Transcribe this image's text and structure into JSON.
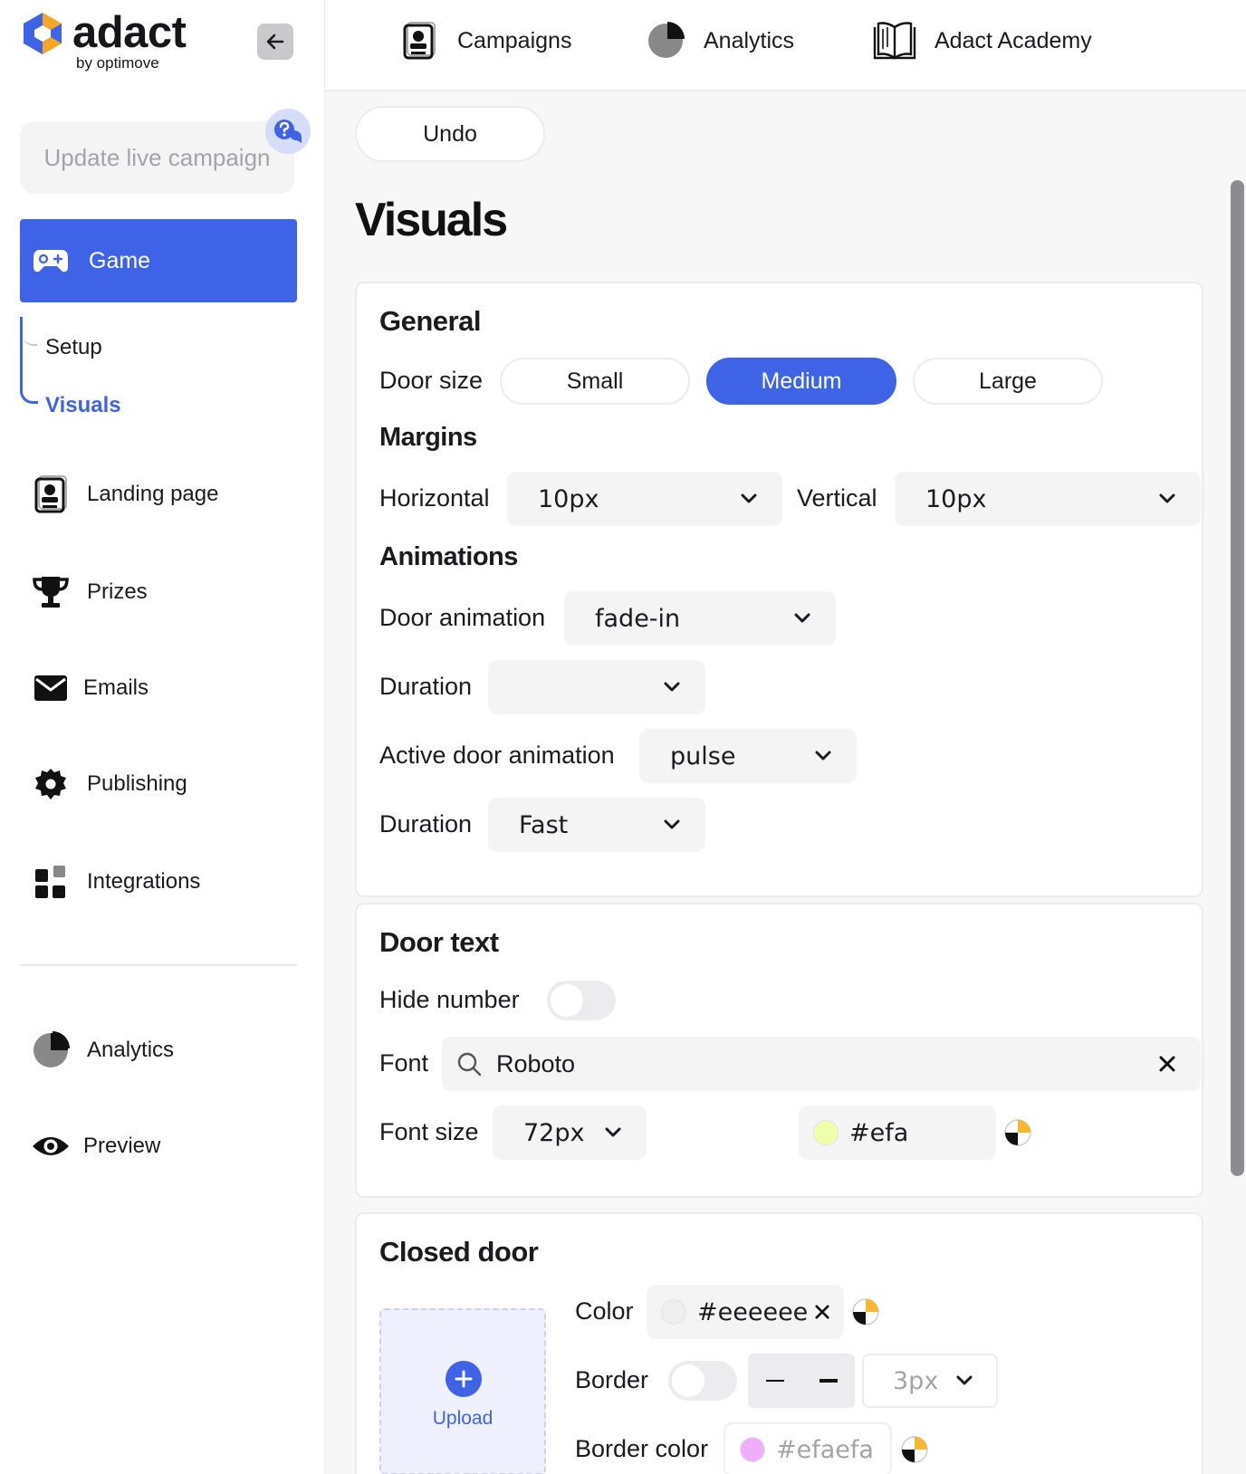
{
  "brand": {
    "name": "adact",
    "tagline": "by optimove",
    "colors": {
      "accent": "#3f63e6",
      "logo_orange": "#f5a623",
      "logo_blue": "#3f63e6"
    }
  },
  "sidebar": {
    "collapse_icon": "arrow-left-icon",
    "update_button": "Update live campaign",
    "help_icon": "help-chat-icon",
    "game": {
      "label": "Game",
      "icon": "gamepad-icon"
    },
    "game_subitems": [
      {
        "label": "Setup",
        "active": false
      },
      {
        "label": "Visuals",
        "active": true
      }
    ],
    "items": [
      {
        "label": "Landing page",
        "icon": "landing-page-icon"
      },
      {
        "label": "Prizes",
        "icon": "trophy-icon"
      },
      {
        "label": "Emails",
        "icon": "envelope-icon"
      },
      {
        "label": "Publishing",
        "icon": "gear-icon"
      },
      {
        "label": "Integrations",
        "icon": "integrations-grid-icon"
      }
    ],
    "bottom_items": [
      {
        "label": "Analytics",
        "icon": "pie-chart-icon"
      },
      {
        "label": "Preview",
        "icon": "eye-icon"
      }
    ]
  },
  "topnav": [
    {
      "label": "Campaigns",
      "icon": "campaigns-icon"
    },
    {
      "label": "Analytics",
      "icon": "pie-chart-icon"
    },
    {
      "label": "Adact Academy",
      "icon": "book-icon"
    }
  ],
  "main": {
    "undo_label": "Undo",
    "page_title": "Visuals",
    "general": {
      "title": "General",
      "door_size_label": "Door size",
      "door_sizes": [
        "Small",
        "Medium",
        "Large"
      ],
      "door_size_selected": "Medium",
      "margins_title": "Margins",
      "horizontal_label": "Horizontal",
      "horizontal_value": "10px",
      "vertical_label": "Vertical",
      "vertical_value": "10px",
      "animations_title": "Animations",
      "door_animation_label": "Door animation",
      "door_animation_value": "fade-in",
      "duration1_label": "Duration",
      "duration1_value": "",
      "active_door_animation_label": "Active door animation",
      "active_door_animation_value": "pulse",
      "duration2_label": "Duration",
      "duration2_value": "Fast"
    },
    "door_text": {
      "title": "Door text",
      "hide_number_label": "Hide number",
      "hide_number_on": false,
      "font_label": "Font",
      "font_value": "Roboto",
      "font_size_label": "Font size",
      "font_size_value": "72px",
      "color_value": "#efa",
      "color_swatch": "#eeffaa"
    },
    "closed_door": {
      "title": "Closed door",
      "upload_label": "Upload",
      "color_label": "Color",
      "color_value": "#eeeeee",
      "color_swatch": "#eeeeee",
      "border_label": "Border",
      "border_on": false,
      "border_width_value": "3px",
      "border_color_label": "Border color",
      "border_color_value": "#efaefa",
      "border_color_swatch": "#efaefa"
    }
  }
}
